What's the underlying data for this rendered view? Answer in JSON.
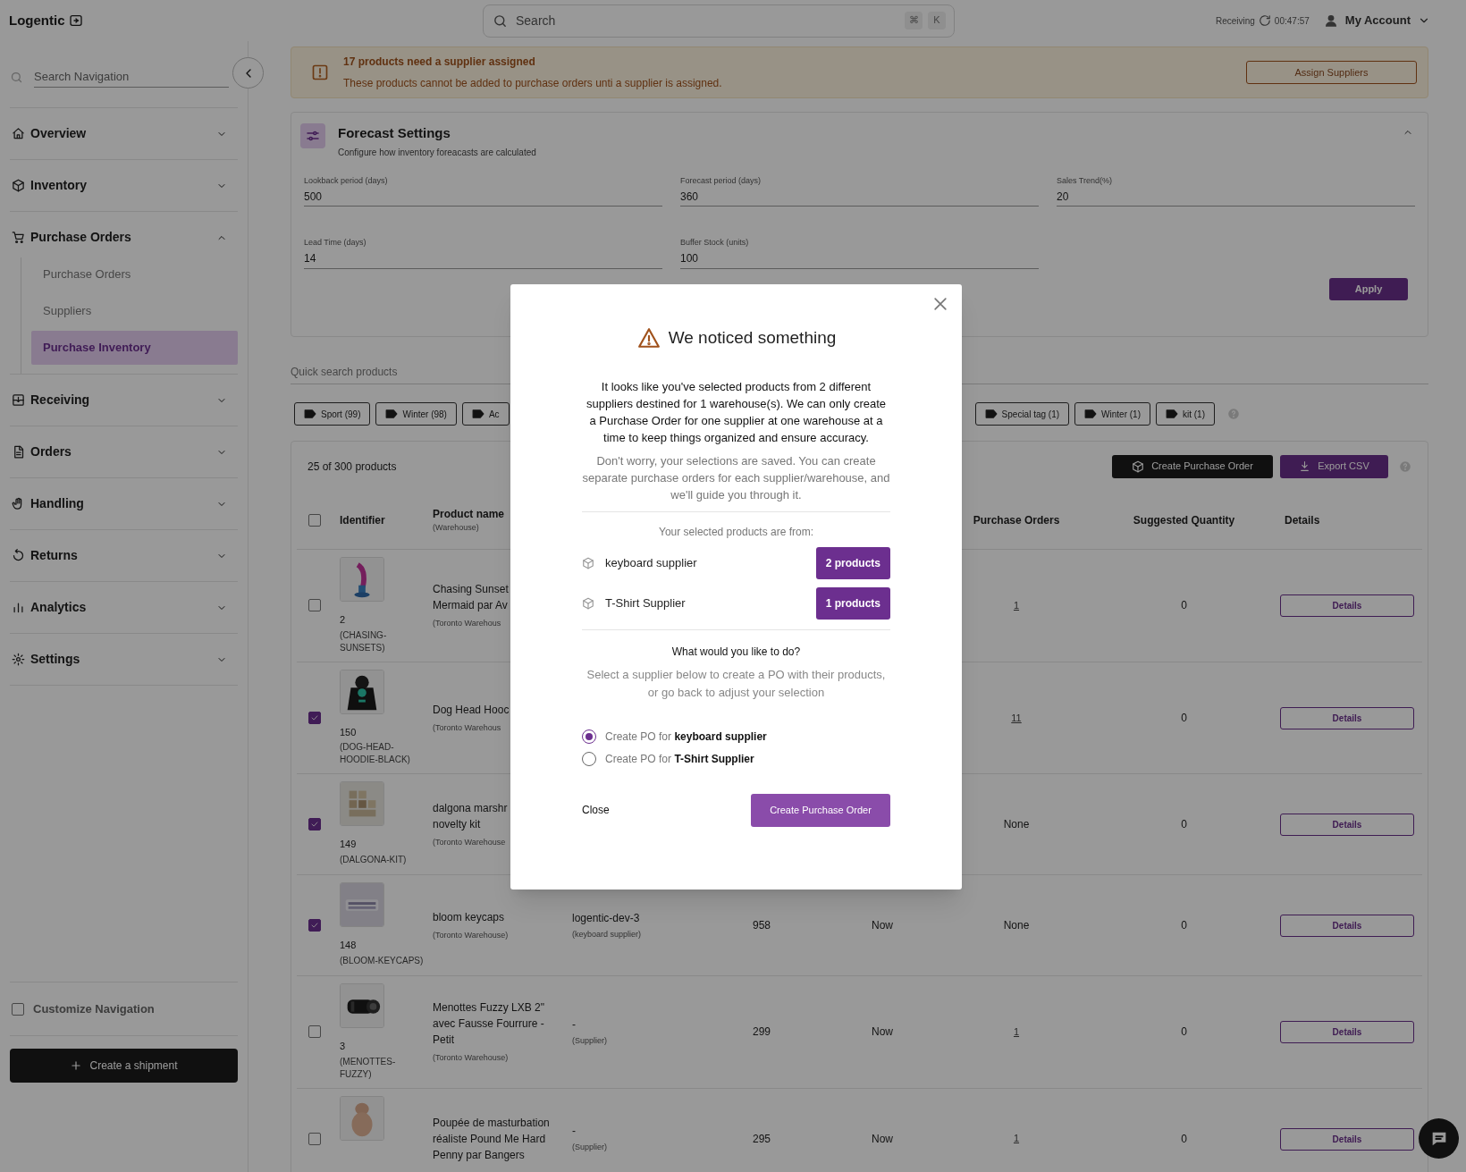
{
  "header": {
    "logo": "Logentic",
    "search_placeholder": "Search",
    "shortcut_keys": [
      "⌘",
      "K"
    ],
    "receiving_label": "Receiving",
    "receiving_time": "00:47:57",
    "account_label": "My Account"
  },
  "sidebar": {
    "search_placeholder": "Search Navigation",
    "items": [
      {
        "label": "Overview",
        "expanded": false
      },
      {
        "label": "Inventory",
        "expanded": false
      },
      {
        "label": "Purchase Orders",
        "expanded": true,
        "children": [
          {
            "label": "Purchase Orders",
            "selected": false
          },
          {
            "label": "Suppliers",
            "selected": false
          },
          {
            "label": "Purchase Inventory",
            "selected": true
          }
        ]
      },
      {
        "label": "Receiving",
        "expanded": false
      },
      {
        "label": "Orders",
        "expanded": false
      },
      {
        "label": "Handling",
        "expanded": false
      },
      {
        "label": "Returns",
        "expanded": false
      },
      {
        "label": "Analytics",
        "expanded": false
      },
      {
        "label": "Settings",
        "expanded": false
      }
    ],
    "customize": {
      "label": "Customize Navigation",
      "checked": false
    },
    "create_button": "Create a shipment"
  },
  "banner": {
    "title": "17 products need a supplier assigned",
    "message": "These products cannot be added to purchase orders unti a supplier is assigned.",
    "button": "Assign Suppliers"
  },
  "forecast": {
    "title": "Forecast Settings",
    "subtitle": "Configure how inventory foreacasts are calculated",
    "expanded": true,
    "fields": [
      {
        "label": "Lookback period (days)",
        "value": "500"
      },
      {
        "label": "Forecast period (days)",
        "value": "360"
      },
      {
        "label": "Sales Trend(%)",
        "value": "20"
      },
      {
        "label": "Lead Time (days)",
        "value": "14"
      },
      {
        "label": "Buffer Stock (units)",
        "value": "100"
      }
    ],
    "apply_button": "Apply"
  },
  "quick_search": {
    "placeholder": "Quick search products"
  },
  "tags_before": [
    {
      "label": "Sport (99)"
    },
    {
      "label": "Winter (98)"
    },
    {
      "label": "Ac"
    }
  ],
  "tags_after": [
    {
      "label": "Special tag (1)"
    },
    {
      "label": "Winter (1)"
    },
    {
      "label": "kit (1)"
    }
  ],
  "table": {
    "count": "25 of 300 products",
    "create_button": "Create Purchase Order",
    "export_button": "Export CSV",
    "all_checked": false,
    "columns": [
      {
        "label": "Identifier"
      },
      {
        "label": "Product name",
        "sublabel": "(Warehouse)"
      },
      {
        "label": "Purchase Orders"
      },
      {
        "label": "Suggested Quantity"
      },
      {
        "label": "Details"
      }
    ],
    "rows": [
      {
        "checked": false,
        "id": "2",
        "sku": "(CHASING-SUNSETS)",
        "name": "Chasing Sunset Mermaid par Av",
        "warehouse": "(Toronto Warehous",
        "purchase_orders": "1",
        "po_link": true,
        "suggested": "0",
        "details": "Details"
      },
      {
        "checked": true,
        "id": "150",
        "sku": "(DOG-HEAD-HOODIE-BLACK)",
        "name": "Dog Head Hooc",
        "warehouse": "(Toronto Warehous",
        "purchase_orders": "11",
        "po_link": true,
        "suggested": "0",
        "details": "Details"
      },
      {
        "checked": true,
        "id": "149",
        "sku": "(DALGONA-KIT)",
        "name": "dalgona marshr novelty kit",
        "warehouse": "(Toronto Warehouse",
        "purchase_orders": "None",
        "po_link": false,
        "suggested": "0",
        "details": "Details"
      },
      {
        "checked": true,
        "id": "148",
        "sku": "(BLOOM-KEYCAPS)",
        "name": "bloom keycaps",
        "warehouse": "(Toronto Warehouse)",
        "supplier": "logentic-dev-3",
        "supplier_sub": "(keyboard supplier)",
        "quantity": "958",
        "timing": "Now",
        "purchase_orders": "None",
        "po_link": false,
        "suggested": "0",
        "details": "Details"
      },
      {
        "checked": false,
        "id": "3",
        "sku": "(MENOTTES-FUZZY)",
        "name": "Menottes Fuzzy LXB 2\" avec Fausse Fourrure - Petit",
        "warehouse": "(Toronto Warehouse)",
        "supplier": "-",
        "supplier_sub": "(Supplier)",
        "quantity": "299",
        "timing": "Now",
        "purchase_orders": "1",
        "po_link": true,
        "suggested": "0",
        "details": "Details"
      },
      {
        "checked": false,
        "name": "Poupée de masturbation réaliste Pound Me Hard Penny par Bangers",
        "supplier": "-",
        "supplier_sub": "(Supplier)",
        "quantity": "295",
        "timing": "Now",
        "purchase_orders": "1",
        "po_link": true,
        "suggested": "0",
        "details": "Details"
      }
    ]
  },
  "modal": {
    "title": "We noticed something",
    "message": "It looks like you've selected products from 2 different suppliers destined for 1 warehouse(s). We can only create a Purchase Order for one supplier at one warehouse at a time to keep things organized and ensure accuracy.",
    "note": "Don't worry, your selections are saved. You can create separate purchase orders for each supplier/warehouse, and we'll guide you through it.",
    "sources_label": "Your selected products are from:",
    "suppliers": [
      {
        "name": "keyboard supplier",
        "count": "2 products"
      },
      {
        "name": "T-Shirt Supplier",
        "count": "1 products"
      }
    ],
    "question": "What would you like to do?",
    "hint": "Select a supplier below to create a PO with their products, or go back to adjust your selection",
    "options": [
      {
        "label": "Create PO for **keyboard supplier**",
        "selected": true
      },
      {
        "label": "Create PO for **T-Shirt Supplier**",
        "selected": false
      }
    ],
    "close_button": "Close",
    "primary_button": "Create Purchase Order"
  }
}
